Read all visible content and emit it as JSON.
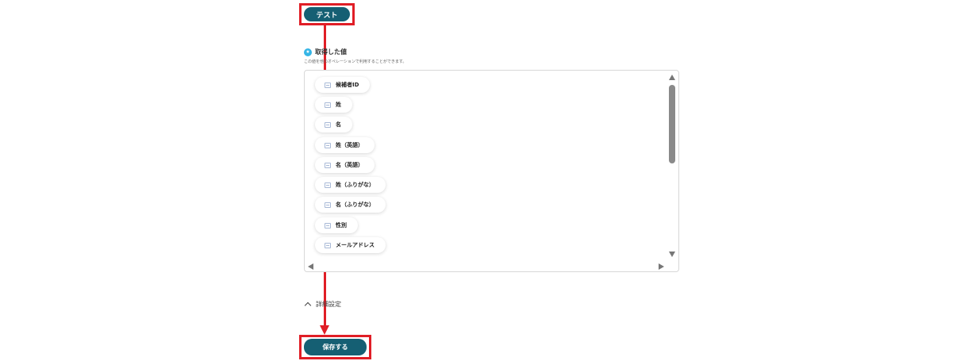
{
  "test_button": {
    "label": "テスト"
  },
  "retrieved_values": {
    "title": "取得した値",
    "description": "この値を他のオペレーションで利用することができます。",
    "items": [
      {
        "label": "候補者ID"
      },
      {
        "label": "姓"
      },
      {
        "label": "名"
      },
      {
        "label": "姓（英語）"
      },
      {
        "label": "名（英語）"
      },
      {
        "label": "姓（ふりがな）"
      },
      {
        "label": "名（ふりがな）"
      },
      {
        "label": "性別"
      },
      {
        "label": "メールアドレス"
      }
    ]
  },
  "advanced_settings": {
    "label": "詳細設定"
  },
  "save_button": {
    "label": "保存する"
  },
  "colors": {
    "primary_button": "#155f73",
    "highlight": "#e01e26",
    "badge": "#35b5e6"
  }
}
